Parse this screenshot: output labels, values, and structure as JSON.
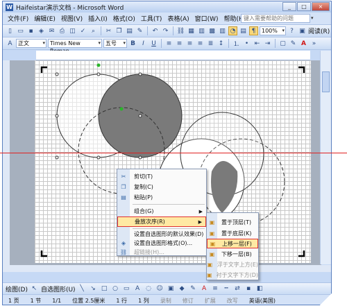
{
  "window": {
    "title": "Haifeistar演示文档 - Microsoft Word",
    "controls": [
      "_",
      "□",
      "×"
    ]
  },
  "menubar": {
    "items": [
      "文件(F)",
      "编辑(E)",
      "视图(V)",
      "插入(I)",
      "格式(O)",
      "工具(T)",
      "表格(A)",
      "窗口(W)",
      "帮助(H)"
    ],
    "help_placeholder": "键入需要帮助的问题"
  },
  "toolbar_standard": {
    "zoom": "100%",
    "reading": "阅读(R)"
  },
  "toolbar_format": {
    "style": "正文",
    "font": "Times New Roman",
    "size": "五号",
    "bold": "B",
    "italic": "I",
    "underline": "U",
    "font_color_label": "A"
  },
  "context_menu": {
    "items": [
      {
        "label": "剪切(T)",
        "icon": "scissors-icon",
        "enabled": true
      },
      {
        "label": "复制(C)",
        "icon": "copy-icon",
        "enabled": true
      },
      {
        "label": "粘贴(P)",
        "icon": "paste-icon",
        "enabled": true
      },
      {
        "label": "组合(G)",
        "icon": "",
        "enabled": true,
        "submenu": true
      },
      {
        "label": "叠放次序(R)",
        "icon": "",
        "enabled": true,
        "submenu": true,
        "selected": true
      },
      {
        "label": "设置自选图形的默认效果(D)",
        "icon": "",
        "enabled": true
      },
      {
        "label": "设置自选图形格式(O)...",
        "icon": "format-icon",
        "enabled": true
      },
      {
        "label": "超链接(H)...",
        "icon": "hyperlink-icon",
        "enabled": false
      }
    ]
  },
  "submenu": {
    "items": [
      {
        "label": "置于顶层(T)",
        "enabled": true
      },
      {
        "label": "置于底层(K)",
        "enabled": true
      },
      {
        "label": "上移一层(F)",
        "enabled": true,
        "selected": true
      },
      {
        "label": "下移一层(B)",
        "enabled": true
      },
      {
        "label": "浮于文字上方(E)",
        "enabled": false
      },
      {
        "label": "衬于文字下方(D)",
        "enabled": false
      }
    ]
  },
  "drawbar": {
    "draw": "绘图(D)",
    "autoshapes": "自选图形(U)"
  },
  "statusbar": {
    "page": "1 页",
    "section": "1 节",
    "pages": "1/1",
    "position": "位置 2.5厘米",
    "line": "1 行",
    "column": "1 列",
    "rec": "录制",
    "trk": "修订",
    "ext": "扩展",
    "ovr": "改写",
    "lang": "英语(美国)"
  },
  "colors": {
    "accent": "#2b5aa6",
    "highlight": "#ffe9a3",
    "selection_border": "#e03030",
    "shape_fill": "#7a7a7a"
  }
}
